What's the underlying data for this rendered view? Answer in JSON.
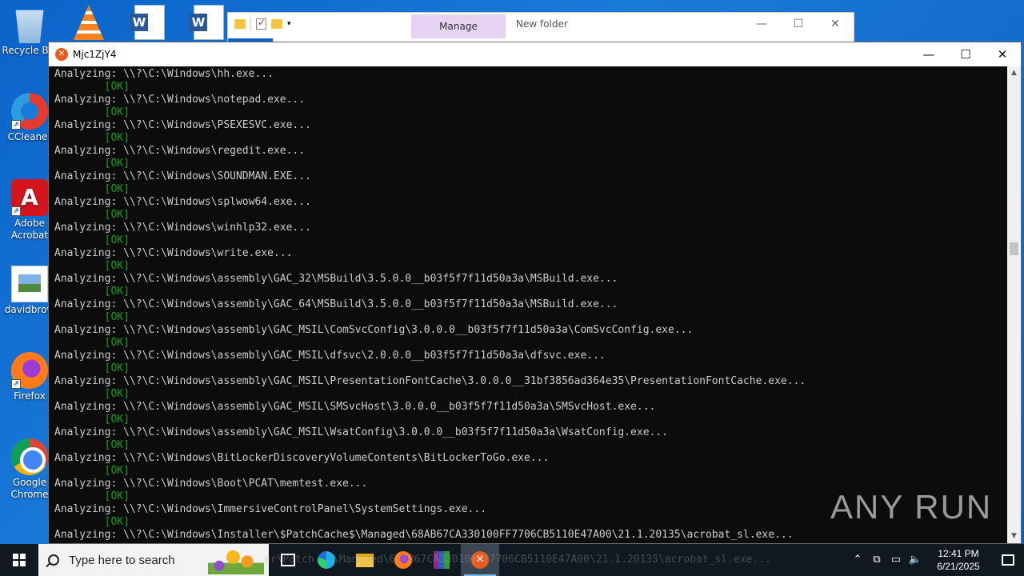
{
  "desktop": {
    "icons": [
      {
        "label": "Recycle Bin",
        "icon": "recycle-bin-icon"
      },
      {
        "label": "CCleaner",
        "icon": "ccleaner-icon"
      },
      {
        "label": "Adobe Acrobat",
        "icon": "acrobat-icon"
      },
      {
        "label": "davidbrow",
        "icon": "image-file-icon"
      },
      {
        "label": "Firefox",
        "icon": "firefox-icon"
      },
      {
        "label": "Google Chrome",
        "icon": "chrome-icon"
      }
    ]
  },
  "explorer": {
    "manage_tab": "Manage",
    "title": "New folder",
    "minimize": "—",
    "maximize": "☐",
    "close": "✕"
  },
  "console": {
    "title": "Mjc1ZjY4",
    "minimize": "—",
    "maximize": "☐",
    "close": "✕",
    "ok_text": "        [OK]",
    "lines": [
      "Analyzing: \\\\?\\C:\\Windows\\hh.exe...",
      "Analyzing: \\\\?\\C:\\Windows\\notepad.exe...",
      "Analyzing: \\\\?\\C:\\Windows\\PSEXESVC.exe...",
      "Analyzing: \\\\?\\C:\\Windows\\regedit.exe...",
      "Analyzing: \\\\?\\C:\\Windows\\SOUNDMAN.EXE...",
      "Analyzing: \\\\?\\C:\\Windows\\splwow64.exe...",
      "Analyzing: \\\\?\\C:\\Windows\\winhlp32.exe...",
      "Analyzing: \\\\?\\C:\\Windows\\write.exe...",
      "Analyzing: \\\\?\\C:\\Windows\\assembly\\GAC_32\\MSBuild\\3.5.0.0__b03f5f7f11d50a3a\\MSBuild.exe...",
      "Analyzing: \\\\?\\C:\\Windows\\assembly\\GAC_64\\MSBuild\\3.5.0.0__b03f5f7f11d50a3a\\MSBuild.exe...",
      "Analyzing: \\\\?\\C:\\Windows\\assembly\\GAC_MSIL\\ComSvcConfig\\3.0.0.0__b03f5f7f11d50a3a\\ComSvcConfig.exe...",
      "Analyzing: \\\\?\\C:\\Windows\\assembly\\GAC_MSIL\\dfsvc\\2.0.0.0__b03f5f7f11d50a3a\\dfsvc.exe...",
      "Analyzing: \\\\?\\C:\\Windows\\assembly\\GAC_MSIL\\PresentationFontCache\\3.0.0.0__31bf3856ad364e35\\PresentationFontCache.exe...",
      "Analyzing: \\\\?\\C:\\Windows\\assembly\\GAC_MSIL\\SMSvcHost\\3.0.0.0__b03f5f7f11d50a3a\\SMSvcHost.exe...",
      "Analyzing: \\\\?\\C:\\Windows\\assembly\\GAC_MSIL\\WsatConfig\\3.0.0.0__b03f5f7f11d50a3a\\WsatConfig.exe...",
      "Analyzing: \\\\?\\C:\\Windows\\BitLockerDiscoveryVolumeContents\\BitLockerToGo.exe...",
      "Analyzing: \\\\?\\C:\\Windows\\Boot\\PCAT\\memtest.exe...",
      "Analyzing: \\\\?\\C:\\Windows\\ImmersiveControlPanel\\SystemSettings.exe...",
      "Analyzing: \\\\?\\C:\\Windows\\Installer\\$PatchCache$\\Managed\\68AB67CA330100FF7706CB5110E47A00\\21.1.20135\\acrobat_sl.exe..."
    ]
  },
  "watermark": {
    "text": "ANY RUN"
  },
  "taskbar": {
    "search_placeholder": "Type here to search",
    "ghost_text": "er\\Patch...\\Managed\\68AB67CA330100FF7706CB5110E47A00\\21.1.20135\\acrobat_sl.exe...",
    "time": "12:41 PM",
    "date": "6/21/2025"
  }
}
